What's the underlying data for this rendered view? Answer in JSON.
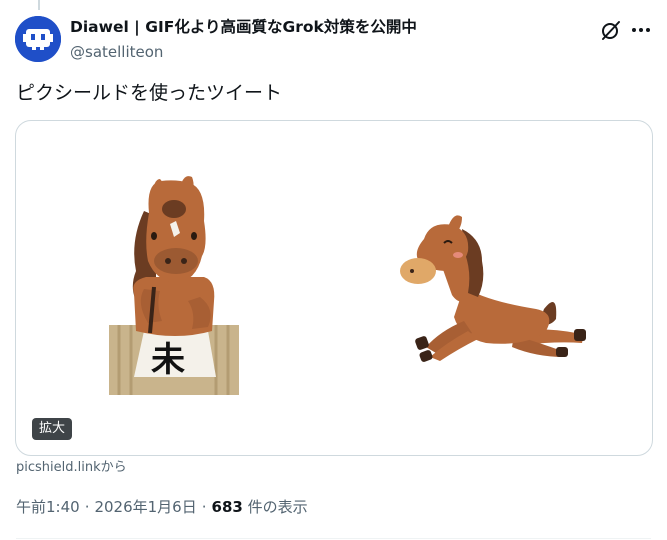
{
  "author": {
    "display_name": "Diawel | GIF化より高画質なGrok対策を公開中",
    "handle": "@satelliteon"
  },
  "header_icons": {
    "grok": "grok-icon",
    "more": "more-icon"
  },
  "tweet": {
    "text": "ピクシールドを使ったツイート"
  },
  "media": {
    "expand_label": "拡大",
    "left_sign_character": "未",
    "illustrations": [
      "horse-writing-calligraphy",
      "horse-galloping"
    ]
  },
  "source": {
    "link_text": "picshield.linkから"
  },
  "meta": {
    "time": "午前1:40",
    "separator": "·",
    "date": "2026年1月6日",
    "views_count": "683",
    "views_label": " 件の表示"
  },
  "colors": {
    "text_primary": "#0f1419",
    "text_secondary": "#536471",
    "border": "#cfd9de",
    "avatar_bg": "#1f4fc8",
    "badge_bg": "#3f4448",
    "horse_body": "#b86a3a",
    "horse_mane": "#6b3c22"
  }
}
